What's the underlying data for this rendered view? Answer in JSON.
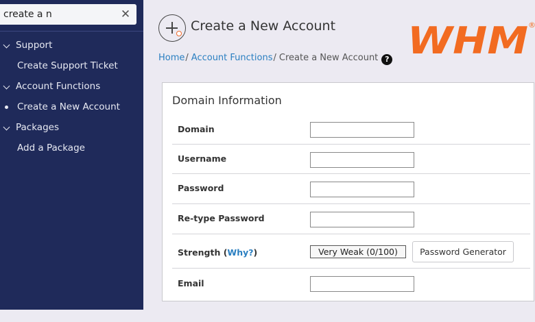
{
  "sidebar": {
    "search": {
      "value": "create a n",
      "clear_icon": "close-icon"
    },
    "items": [
      {
        "type": "category",
        "label": "Support",
        "icon": "chevron-down-icon"
      },
      {
        "type": "link",
        "label": "Create Support Ticket"
      },
      {
        "type": "category",
        "label": "Account Functions",
        "icon": "chevron-down-icon"
      },
      {
        "type": "link",
        "label": "Create a New Account",
        "active": true,
        "icon": "bullet-icon"
      },
      {
        "type": "category",
        "label": "Packages",
        "icon": "chevron-down-icon"
      },
      {
        "type": "link",
        "label": "Add a Package"
      }
    ]
  },
  "header": {
    "title": "Create a New Account",
    "icon": "add-account-icon",
    "logo_text": "WHM",
    "logo_mark": "®",
    "brand_color": "#f26b21"
  },
  "breadcrumb": {
    "items": [
      "Home",
      "Account Functions"
    ],
    "separator": "/",
    "current": "Create a New Account",
    "help_icon": "question-circle-icon",
    "help_glyph": "?"
  },
  "form": {
    "section_title": "Domain Information",
    "domain_label": "Domain",
    "domain_value": "",
    "username_label": "Username",
    "username_value": "",
    "password_label": "Password",
    "password_value": "",
    "retype_label": "Re-type Password",
    "retype_value": "",
    "strength_label": "Strength",
    "strength_open": "(",
    "strength_why": "Why?",
    "strength_close": ")",
    "strength_value": "Very Weak (0/100)",
    "generator_label": "Password Generator",
    "email_label": "Email",
    "email_value": ""
  },
  "colors": {
    "sidebar_bg": "#1f2a5a",
    "link": "#2a7fc1",
    "page_bg": "#eceaf2"
  }
}
